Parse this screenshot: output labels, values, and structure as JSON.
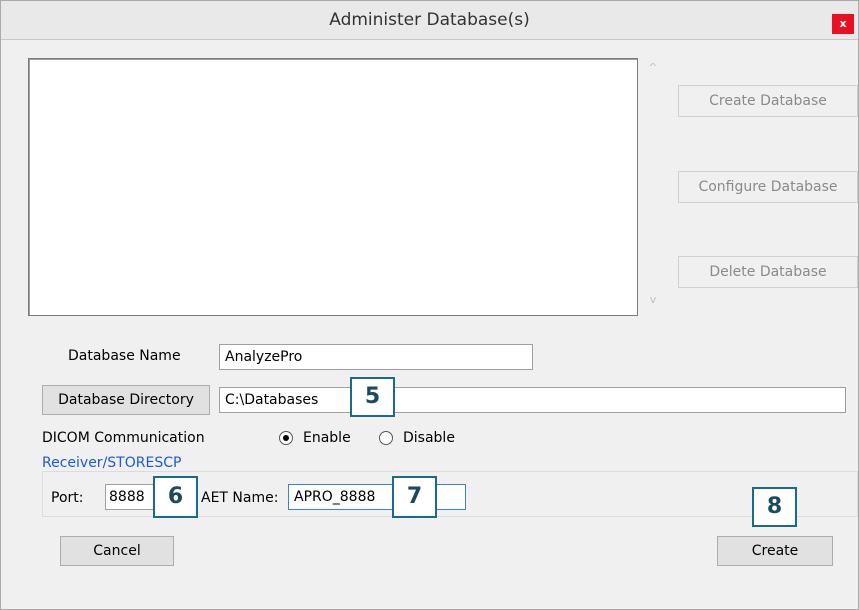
{
  "window": {
    "title": "Administer Database(s)",
    "close_label": "x"
  },
  "scroll": {
    "up_icon": "chevron-up-icon",
    "down_icon": "chevron-down-icon",
    "up_glyph": "^",
    "down_glyph": "v"
  },
  "side_buttons": {
    "create_db": "Create Database",
    "configure_db": "Configure Database",
    "delete_db": "Delete Database"
  },
  "form": {
    "db_name_label": "Database Name",
    "db_name_value": "AnalyzePro",
    "db_dir_button": "Database Directory",
    "db_dir_value": "C:\\Databases",
    "dicom_label": "DICOM Communication",
    "enable_label": "Enable",
    "disable_label": "Disable",
    "dicom_selected": "Enable",
    "group_label": "Receiver/STORESCP",
    "port_label": "Port:",
    "port_value": "8888",
    "aet_label": "AET Name:",
    "aet_value": "APRO_8888"
  },
  "buttons": {
    "cancel": "Cancel",
    "create": "Create"
  },
  "callouts": {
    "c5": "5",
    "c6": "6",
    "c7": "7",
    "c8": "8"
  }
}
